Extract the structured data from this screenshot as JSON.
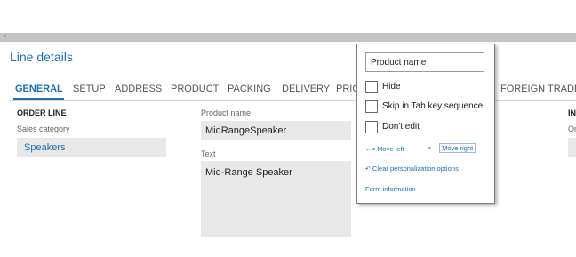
{
  "window": {
    "scroll_left_glyph": "<"
  },
  "form": {
    "title": "Line details"
  },
  "tabs": [
    {
      "label": "GENERAL",
      "active": true
    },
    {
      "label": "SETUP"
    },
    {
      "label": "ADDRESS"
    },
    {
      "label": "PRODUCT"
    },
    {
      "label": "PACKING"
    },
    {
      "label": "DELIVERY"
    },
    {
      "label": "PRIC"
    },
    {
      "label": "FOREIGN TRADE"
    }
  ],
  "order_line": {
    "heading": "ORDER LINE",
    "sales_category_label": "Sales category",
    "sales_category_value": "Speakers"
  },
  "product": {
    "name_label": "Product name",
    "name_value": "MidRangeSpeaker",
    "text_label": "Text",
    "text_value": "Mid-Range Speaker"
  },
  "right_column": {
    "heading_partial": "IN",
    "label_partial": "Or"
  },
  "popup": {
    "field_label": "Product name",
    "hide_label": "Hide",
    "skip_label": "Skip in Tab key sequence",
    "dont_edit_label": "Don't edit",
    "move_left_label": "Move left",
    "move_right_label": "Move right",
    "clear_label": "Clear personalization options",
    "form_info_label": "Form information",
    "icons": {
      "move_left": "move-left-icon",
      "move_right": "move-right-icon",
      "clear": "clear-personalization-icon"
    }
  },
  "colors": {
    "accent": "#1f6fb2",
    "field_bg": "#e8e8e8",
    "scrollbar": "#c4c4c4"
  }
}
